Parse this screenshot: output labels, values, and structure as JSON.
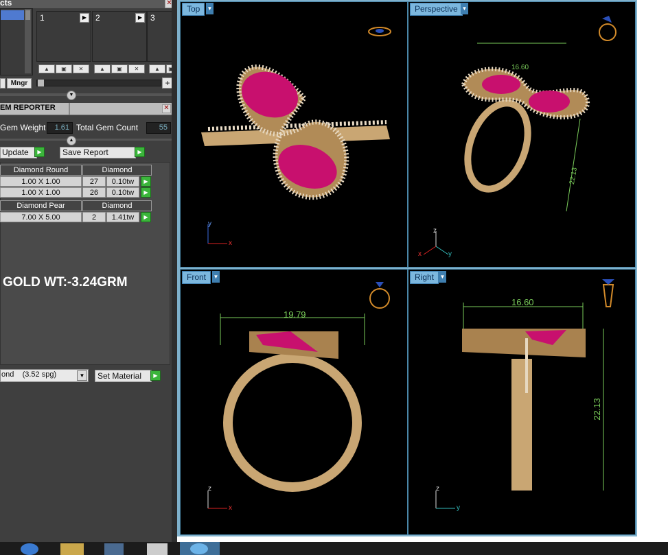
{
  "top_panel": {
    "title": "cts",
    "slots": [
      "1",
      "2",
      "3"
    ],
    "mngr_label": "Mngr"
  },
  "gem_reporter": {
    "title": "EM REPORTER",
    "gem_weight_label": "Gem Weight",
    "gem_weight_value": "1.61",
    "total_count_label": "Total Gem Count",
    "total_count_value": "55",
    "update_label": "Update",
    "save_report_label": "Save Report",
    "groups": [
      {
        "shape": "Diamond Round",
        "material": "Diamond",
        "rows": [
          {
            "size": "1.00 X 1.00",
            "count": "27",
            "weight": "0.10tw"
          },
          {
            "size": "1.00 X 1.00",
            "count": "26",
            "weight": "0.10tw"
          }
        ]
      },
      {
        "shape": "Diamond Pear",
        "material": "Diamond",
        "rows": [
          {
            "size": "7.00 X 5.00",
            "count": "2",
            "weight": "1.41tw"
          }
        ]
      }
    ],
    "gold_weight_text": "GOLD WT:-3.24GRM",
    "material_select": "ond    (3.52 spg)",
    "set_material_label": "Set Material"
  },
  "viewports": {
    "top": {
      "label": "Top"
    },
    "perspective": {
      "label": "Perspective",
      "dim_a": "16.60",
      "dim_b": "22.13"
    },
    "front": {
      "label": "Front",
      "width_dim": "19.79"
    },
    "right": {
      "label": "Right",
      "width_dim": "16.60",
      "height_dim": "22.13"
    }
  },
  "axes": {
    "x": "x",
    "y": "y",
    "z": "z"
  },
  "colors": {
    "ruby": "#c8106e",
    "gold": "#c9a673",
    "dimension": "#7acc5a",
    "viewport_tab": "#7cb7de"
  }
}
